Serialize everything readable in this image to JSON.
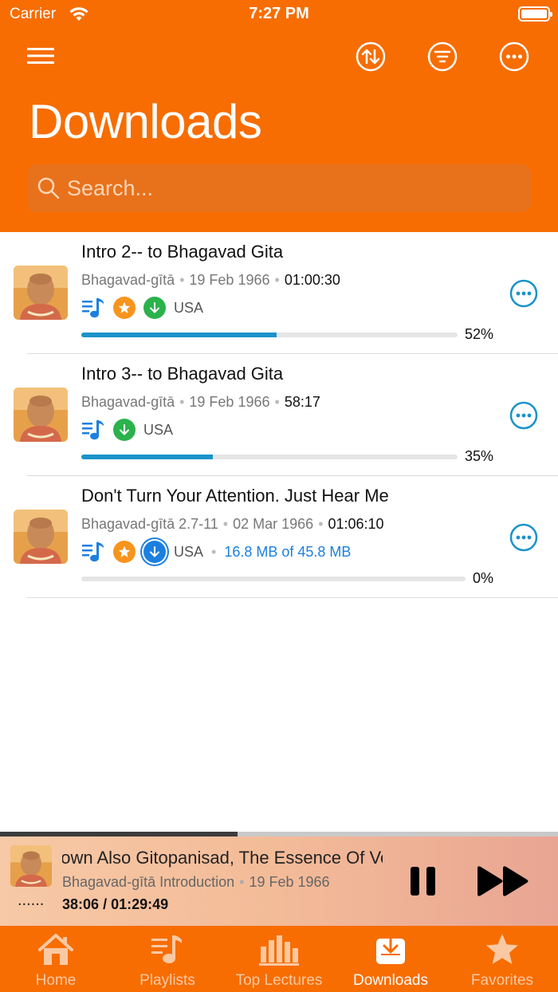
{
  "status_bar": {
    "carrier": "Carrier",
    "time": "7:27 PM"
  },
  "header": {
    "title": "Downloads",
    "icons": [
      "menu-icon",
      "sort-icon",
      "filter-icon",
      "more-icon"
    ]
  },
  "search": {
    "placeholder": "Search..."
  },
  "downloads": [
    {
      "title": "Intro 2-- to Bhagavad Gita",
      "book": "Bhagavad-gītā",
      "date": "19 Feb 1966",
      "duration": "01:00:30",
      "location": "USA",
      "favorite": true,
      "status_icon": "downloaded-check-icon",
      "size_text": "",
      "progress": 52,
      "progress_label": "52%"
    },
    {
      "title": "Intro 3-- to Bhagavad Gita",
      "book": "Bhagavad-gītā",
      "date": "19 Feb 1966",
      "duration": "58:17",
      "location": "USA",
      "favorite": false,
      "status_icon": "downloaded-check-icon",
      "size_text": "",
      "progress": 35,
      "progress_label": "35%"
    },
    {
      "title": "Don't Turn Your Attention. Just Hear Me",
      "book": "Bhagavad-gītā 2.7-11",
      "date": "02 Mar 1966",
      "duration": "01:06:10",
      "location": "USA",
      "favorite": true,
      "status_icon": "downloading-icon",
      "size_text": "16.8 MB of 45.8 MB",
      "progress": 0,
      "progress_label": "0%"
    }
  ],
  "player": {
    "title": "nown Also Gitopanisad, The Essence Of Vedic",
    "book": "Bhagavad-gītā Introduction",
    "date": "19 Feb 1966",
    "dots": "......",
    "elapsed": "38:06",
    "separator": "/",
    "total": "01:29:49",
    "progress": 0.425
  },
  "tabs": [
    {
      "label": "Home",
      "icon": "home-icon",
      "active": false
    },
    {
      "label": "Playlists",
      "icon": "playlist-icon",
      "active": false
    },
    {
      "label": "Top Lectures",
      "icon": "bar-chart-icon",
      "active": false
    },
    {
      "label": "Downloads",
      "icon": "download-tray-icon",
      "active": true
    },
    {
      "label": "Favorites",
      "icon": "star-icon",
      "active": false
    }
  ],
  "colors": {
    "brand_orange": "#f76d02",
    "progress_blue": "#1a93c9",
    "accent_blue": "#1c7fe0",
    "favorite_orange": "#f7941d",
    "downloaded_green": "#2bb24c"
  }
}
